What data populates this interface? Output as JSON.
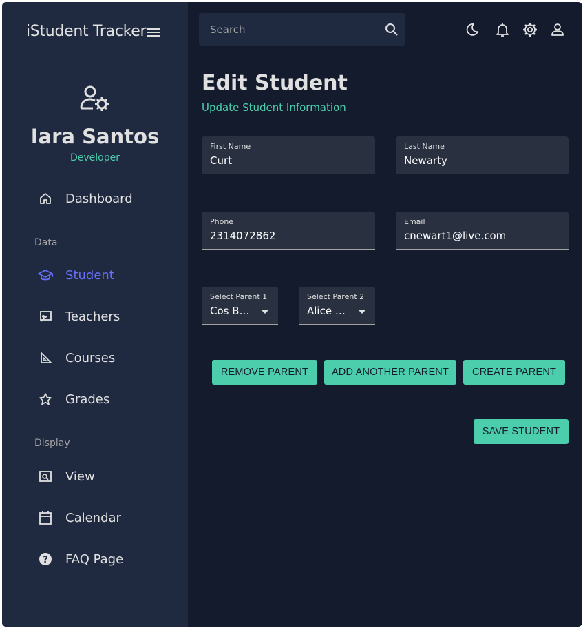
{
  "app": {
    "title": "iStudent Tracker"
  },
  "profile": {
    "name": "Iara Santos",
    "role": "Developer"
  },
  "sidebar": {
    "dashboard": "Dashboard",
    "section_data": "Data",
    "student": "Student",
    "teachers": "Teachers",
    "courses": "Courses",
    "grades": "Grades",
    "section_display": "Display",
    "view": "View",
    "calendar": "Calendar",
    "faq": "FAQ Page"
  },
  "topbar": {
    "search_placeholder": "Search"
  },
  "page": {
    "title": "Edit Student",
    "subtitle": "Update Student Information"
  },
  "form": {
    "first_name": {
      "label": "First Name",
      "value": "Curt"
    },
    "last_name": {
      "label": "Last Name",
      "value": "Newarty"
    },
    "phone": {
      "label": "Phone",
      "value": "2314072862"
    },
    "email": {
      "label": "Email",
      "value": "cnewart1@live.com"
    },
    "parent1": {
      "label": "Select Parent 1",
      "value": "Cos Be…"
    },
    "parent2": {
      "label": "Select Parent 2",
      "value": "Alice Sa…"
    }
  },
  "buttons": {
    "remove_parent": "REMOVE PARENT",
    "add_parent": "ADD ANOTHER PARENT",
    "create_parent": "CREATE PARENT",
    "save_student": "SAVE STUDENT"
  },
  "colors": {
    "background": "#141b2d",
    "sidebar": "#1f2a40",
    "accent_green": "#4cceac",
    "accent_blue": "#6870fa",
    "text": "#e0e0e0"
  },
  "icons": {
    "menu": "hamburger-icon",
    "profile": "user-gear-icon",
    "dashboard": "home-icon",
    "student": "graduation-cap-icon",
    "teachers": "presentation-icon",
    "courses": "set-square-icon",
    "grades": "star-icon",
    "view": "view-window-icon",
    "calendar": "calendar-icon",
    "faq": "help-circle-icon",
    "search": "search-icon",
    "theme": "moon-icon",
    "notifications": "bell-icon",
    "settings": "gear-icon",
    "account": "person-icon"
  }
}
